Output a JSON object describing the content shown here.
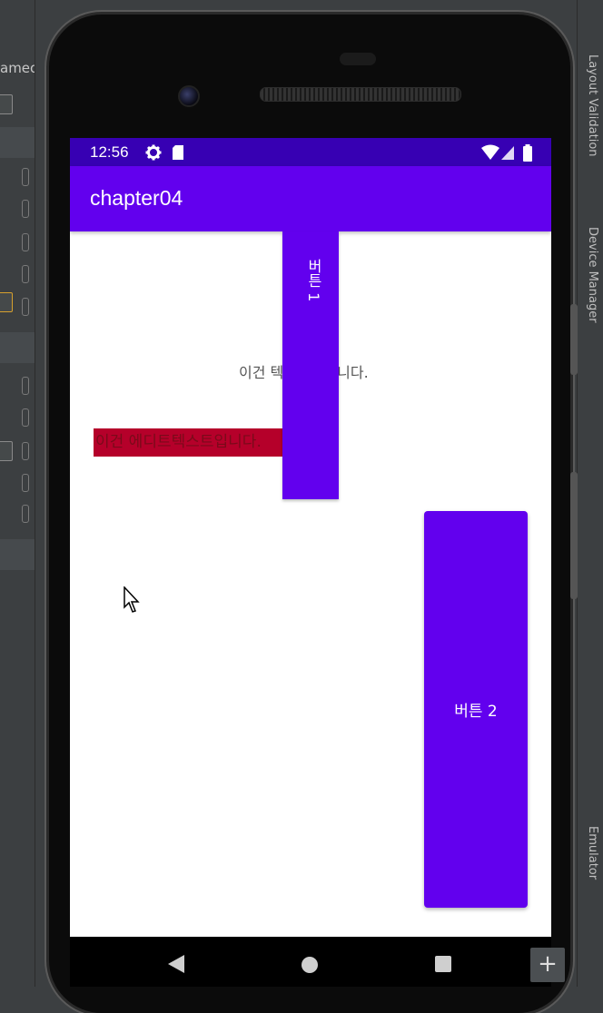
{
  "ide": {
    "left_panel_text": "ameo",
    "right_tabs": [
      "Layout Validation",
      "Device Manager",
      "Emulator"
    ],
    "plus_label": "+"
  },
  "status_bar": {
    "time": "12:56",
    "icons": [
      "gear-icon",
      "sd-card-icon",
      "wifi-icon",
      "signal-icon",
      "battery-icon"
    ]
  },
  "app_bar": {
    "title": "chapter04"
  },
  "content": {
    "text_view": "이건 텍스트뷰입니다.",
    "edit_text": "이건 에디트텍스트입니다.",
    "button1_label": "버튼 1",
    "button2_label": "버튼 2"
  },
  "nav_bar": {
    "icons": [
      "back-icon",
      "home-icon",
      "recents-icon"
    ]
  },
  "colors": {
    "primary": "#6200ee",
    "primary_dark": "#3700b3",
    "edit_text_bg": "#b5002a"
  }
}
